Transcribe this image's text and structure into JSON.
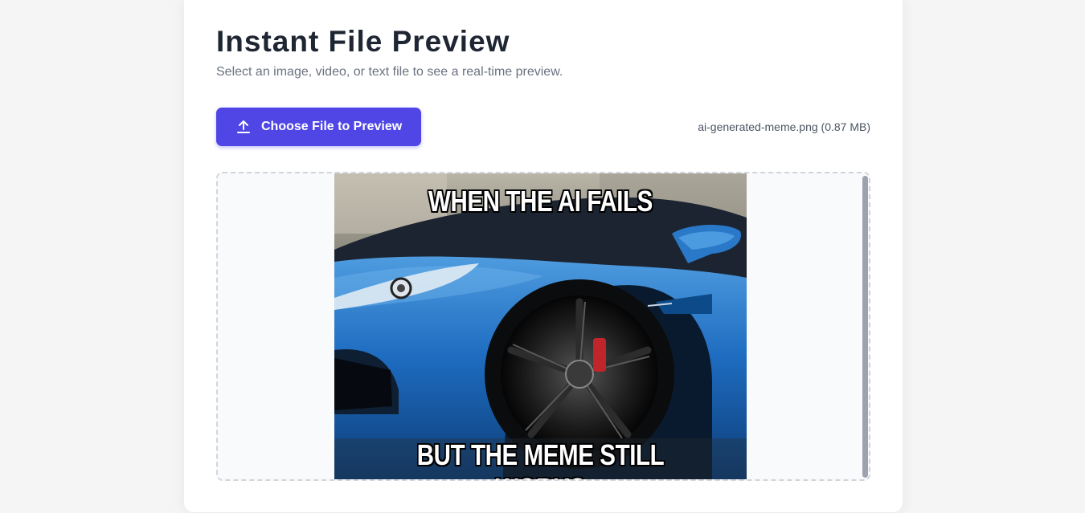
{
  "header": {
    "title": "Instant File Preview",
    "subtitle": "Select an image, video, or text file to see a real-time preview."
  },
  "upload": {
    "button_label": "Choose File to Preview",
    "icon": "upload-icon",
    "file_info": "ai-generated-meme.png (0.87 MB)"
  },
  "preview": {
    "top_text": "WHEN THE AI FAILS",
    "bottom_text": "BUT THE MEME STILL WORKS"
  },
  "colors": {
    "accent": "#4f46e5",
    "car": "#1f6fc0"
  }
}
